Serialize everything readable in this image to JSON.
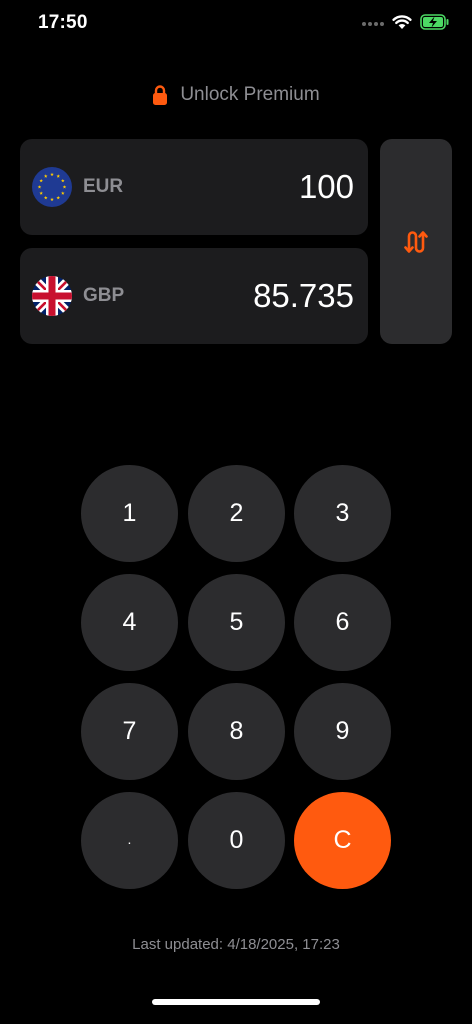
{
  "status_bar": {
    "time": "17:50",
    "icons": [
      "cellular-dots-icon",
      "wifi-icon",
      "battery-charging-icon"
    ]
  },
  "premium": {
    "label": "Unlock Premium",
    "icon": "lock-icon"
  },
  "converter": {
    "from": {
      "code": "EUR",
      "amount": "100",
      "flag": "eu-flag-icon"
    },
    "to": {
      "code": "GBP",
      "amount": "85.735",
      "flag": "uk-flag-icon"
    },
    "swap_icon": "swap-arrows-icon"
  },
  "keypad": {
    "keys": [
      "1",
      "2",
      "3",
      "4",
      "5",
      "6",
      "7",
      "8",
      "9",
      ".",
      "0",
      "C"
    ]
  },
  "footer": {
    "last_updated": "Last updated: 4/18/2025, 17:23"
  },
  "colors": {
    "accent": "#ff5a0f",
    "card": "#1c1c1e",
    "key": "#2c2c2e",
    "muted_text": "#8e8e93",
    "background": "#000000"
  }
}
